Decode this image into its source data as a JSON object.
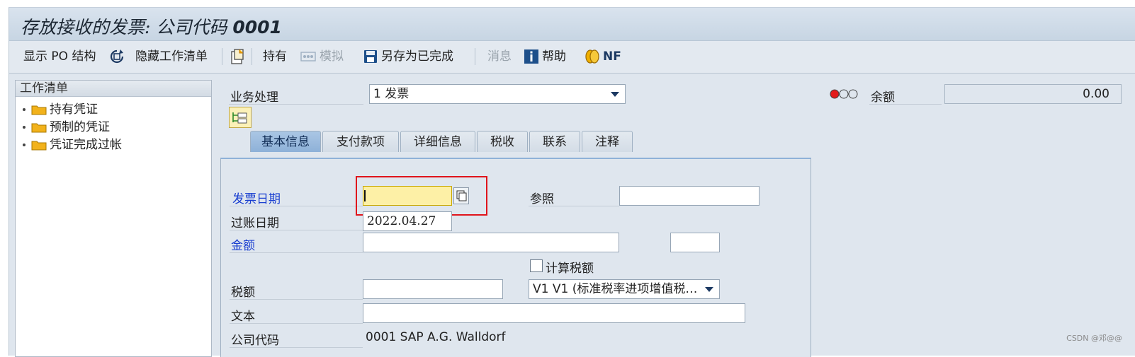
{
  "window": {
    "title": "存放接收的发票: 公司代码",
    "company_code": "0001"
  },
  "toolbar": {
    "show_po": "显示 PO 结构",
    "hide_worklist": "隐藏工作清单",
    "hold": "持有",
    "simulate": "模拟",
    "save_completed": "另存为已完成",
    "messages": "消息",
    "help": "帮助",
    "nf": "NF"
  },
  "worklist": {
    "title": "工作清单",
    "items": [
      {
        "label": "持有凭证"
      },
      {
        "label": "预制的凭证"
      },
      {
        "label": "凭证完成过帐"
      }
    ]
  },
  "header": {
    "transaction_label": "业务处理",
    "transaction_value": "1 发票",
    "balance_label": "余额",
    "balance_value": "0.00"
  },
  "tabs": [
    {
      "label": "基本信息"
    },
    {
      "label": "支付款项"
    },
    {
      "label": "详细信息"
    },
    {
      "label": "税收"
    },
    {
      "label": "联系"
    },
    {
      "label": "注释"
    }
  ],
  "form": {
    "invoice_date_label": "发票日期",
    "invoice_date_value": "",
    "reference_label": "参照",
    "reference_value": "",
    "posting_date_label": "过账日期",
    "posting_date_value": "2022.04.27",
    "amount_label": "金额",
    "amount_value": "",
    "currency_value": "",
    "calc_tax_label": "计算税额",
    "tax_amount_label": "税额",
    "tax_amount_value": "",
    "tax_code_value": "V1 V1 (标准税率进项增值税…",
    "text_label": "文本",
    "text_value": "",
    "company_code_label": "公司代码",
    "company_code_value": "0001 SAP A.G. Walldorf"
  },
  "footer": {
    "watermark": "CSDN @邓@@"
  },
  "colors": {
    "active_tab": "#8eb1d8",
    "highlight": "#e0141b",
    "required_field": "#fdf0a6",
    "blue_label": "#1a3fd0"
  }
}
